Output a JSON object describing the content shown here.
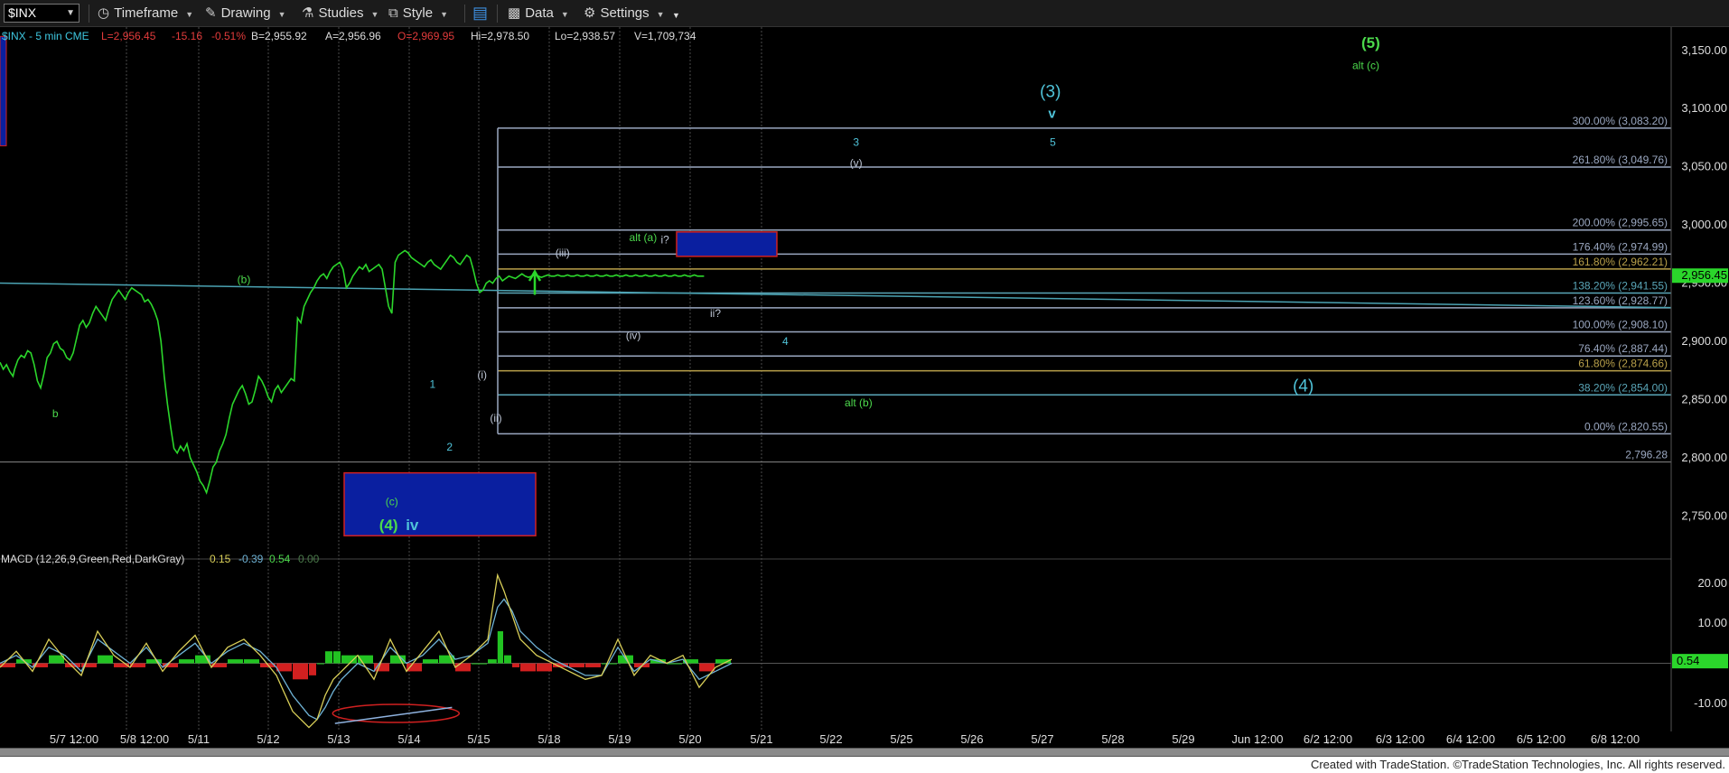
{
  "toolbar": {
    "symbol": "$INX",
    "timeframe": "Timeframe",
    "drawing": "Drawing",
    "studies": "Studies",
    "style": "Style",
    "data": "Data",
    "settings": "Settings"
  },
  "chart_data": {
    "type": "line",
    "header": {
      "symbol_line": "$INX - 5 min  CME",
      "last": "L=2,956.45",
      "change": "-15.16",
      "pct": "-0.51%",
      "bid": "B=2,955.92",
      "ask": "A=2,956.96",
      "open": "O=2,969.95",
      "high": "Hi=2,978.50",
      "low": "Lo=2,938.57",
      "volume": "V=1,709,734"
    },
    "price_axis": {
      "min": 2720,
      "max": 3170,
      "ticks": [
        "2,750.00",
        "2,800.00",
        "2,850.00",
        "2,900.00",
        "2,950.00",
        "3,000.00",
        "3,050.00",
        "3,100.00",
        "3,150.00"
      ],
      "tick_values": [
        2750,
        2800,
        2850,
        2900,
        2950,
        3000,
        3050,
        3100,
        3150
      ],
      "last_price_label": "2,956.45",
      "last_price": 2956.45
    },
    "x_axis": {
      "labels": [
        "5/7 12:00",
        "5/8 12:00",
        "5/11",
        "5/12",
        "5/13",
        "5/14",
        "5/15",
        "5/18",
        "5/19",
        "5/20",
        "5/21",
        "5/22",
        "5/25",
        "5/26",
        "5/27",
        "5/28",
        "5/29",
        "Jun 12:00",
        "6/2 12:00",
        "6/3 12:00",
        "6/4 12:00",
        "6/5 12:00",
        "6/8 12:00"
      ],
      "vertical_grid_labels": [
        "5/8 12:00",
        "5/11",
        "5/12",
        "5/13",
        "5/14",
        "5/15",
        "5/18",
        "5/19",
        "5/20",
        "5/21"
      ]
    },
    "price_series": {
      "name": "$INX",
      "bar_index": [
        0,
        4,
        8,
        12,
        16,
        18,
        22,
        26,
        30,
        34,
        38,
        42,
        46,
        50,
        54,
        58,
        62,
        66,
        70,
        74,
        78,
        82,
        86,
        90,
        94,
        98,
        102,
        106,
        110,
        114,
        118,
        122,
        126,
        130,
        134,
        138,
        142,
        146,
        150,
        154,
        158,
        162,
        166,
        170,
        174,
        178,
        182,
        186,
        190,
        194,
        198,
        202,
        206,
        210,
        214,
        218,
        222,
        226,
        230,
        234,
        238,
        242,
        246,
        250,
        254,
        258,
        262,
        266,
        270,
        274,
        278,
        282,
        286,
        290,
        294,
        298,
        302,
        306,
        310,
        314,
        318,
        322,
        326,
        330,
        334,
        338,
        342,
        346,
        350,
        354,
        358,
        362,
        366,
        370,
        374,
        378,
        382,
        386,
        390,
        394,
        398,
        402,
        406,
        410,
        414,
        418,
        422,
        426,
        430,
        434,
        438,
        442,
        446,
        450,
        454,
        458,
        462,
        466,
        470,
        474,
        478,
        482,
        486,
        490,
        494,
        498,
        502,
        506,
        510,
        514,
        518,
        522,
        526,
        530,
        534,
        538,
        542,
        546,
        550,
        554,
        558,
        562,
        566,
        570,
        574,
        578,
        582,
        586,
        590,
        594,
        598,
        602,
        606,
        610,
        614,
        618,
        622,
        626,
        630,
        634,
        638,
        642,
        646,
        650,
        654,
        658,
        662,
        666,
        670,
        674,
        678,
        682,
        686,
        690,
        694,
        698,
        702,
        706,
        710,
        714,
        718,
        722,
        726,
        730,
        734,
        738,
        742,
        746,
        750,
        754,
        758,
        762,
        766,
        770,
        774,
        778,
        782,
        786,
        790,
        794,
        798,
        802,
        806,
        810,
        814,
        818,
        822,
        826,
        830,
        834,
        838,
        842,
        846,
        850,
        854,
        858,
        862,
        866,
        870,
        874,
        878,
        882,
        886,
        890,
        894,
        898
      ],
      "close": [
        2882,
        2876,
        2880,
        2874,
        2870,
        2876,
        2884,
        2888,
        2886,
        2892,
        2890,
        2880,
        2866,
        2860,
        2872,
        2886,
        2890,
        2898,
        2900,
        2894,
        2892,
        2886,
        2884,
        2890,
        2902,
        2914,
        2918,
        2912,
        2916,
        2924,
        2930,
        2926,
        2922,
        2918,
        2928,
        2936,
        2940,
        2944,
        2940,
        2936,
        2942,
        2946,
        2944,
        2942,
        2940,
        2934,
        2936,
        2932,
        2926,
        2918,
        2900,
        2870,
        2846,
        2826,
        2808,
        2804,
        2810,
        2806,
        2812,
        2800,
        2794,
        2788,
        2780,
        2776,
        2770,
        2780,
        2792,
        2796,
        2806,
        2812,
        2820,
        2834,
        2846,
        2852,
        2858,
        2862,
        2855,
        2846,
        2848,
        2858,
        2870,
        2866,
        2860,
        2852,
        2848,
        2858,
        2862,
        2856,
        2860,
        2864,
        2868,
        2866,
        2920,
        2916,
        2930,
        2936,
        2942,
        2946,
        2952,
        2956,
        2958,
        2954,
        2960,
        2964,
        2966,
        2968,
        2962,
        2946,
        2950,
        2956,
        2960,
        2964,
        2962,
        2966,
        2960,
        2962,
        2964,
        2966,
        2962,
        2946,
        2930,
        2924,
        2968,
        2974,
        2976,
        2978,
        2976,
        2972,
        2970,
        2968,
        2966,
        2964,
        2968,
        2970,
        2966,
        2964,
        2962,
        2966,
        2970,
        2974,
        2972,
        2968,
        2966,
        2970,
        2974,
        2972,
        2962,
        2950,
        2942,
        2944,
        2950,
        2952,
        2950,
        2954,
        2956,
        2952,
        2954,
        2956,
        2955,
        2954,
        2956,
        2958,
        2956,
        2955,
        2956,
        2957,
        2956,
        2955,
        2956,
        2957,
        2956,
        2956,
        2957,
        2956,
        2956,
        2957,
        2956,
        2956,
        2957,
        2956,
        2956,
        2957,
        2956,
        2956,
        2957,
        2956,
        2956,
        2957,
        2956,
        2956,
        2957,
        2956,
        2956,
        2957,
        2956,
        2956,
        2957,
        2956,
        2956,
        2957,
        2956,
        2956,
        2957,
        2956,
        2956,
        2957,
        2956,
        2956,
        2957,
        2956,
        2956,
        2957,
        2956,
        2956,
        2957,
        2956,
        2956,
        2956
      ]
    },
    "fib_levels": [
      {
        "label": "300.00% (3,083.20)",
        "value": 3083.2,
        "color": "#9aa7c0"
      },
      {
        "label": "261.80% (3,049.76)",
        "value": 3049.76,
        "color": "#9aa7c0"
      },
      {
        "label": "200.00% (2,995.65)",
        "value": 2995.65,
        "color": "#9aa7c0"
      },
      {
        "label": "176.40% (2,974.99)",
        "value": 2974.99,
        "color": "#9aa7c0"
      },
      {
        "label": "161.80% (2,962.21)",
        "value": 2962.21,
        "color": "#b9a04a"
      },
      {
        "label": "138.20% (2,941.55)",
        "value": 2941.55,
        "color": "#5aa6b8"
      },
      {
        "label": "123.60% (2,928.77)",
        "value": 2928.77,
        "color": "#9aa7c0"
      },
      {
        "label": "100.00% (2,908.10)",
        "value": 2908.1,
        "color": "#9aa7c0"
      },
      {
        "label": "76.40% (2,887.44)",
        "value": 2887.44,
        "color": "#9aa7c0"
      },
      {
        "label": "61.80% (2,874.66)",
        "value": 2874.66,
        "color": "#b9a04a"
      },
      {
        "label": "38.20% (2,854.00)",
        "value": 2854.0,
        "color": "#5aa6b8"
      },
      {
        "label": "0.00% (2,820.55)",
        "value": 2820.55,
        "color": "#9aa7c0"
      }
    ],
    "support_level": {
      "label": "2,796.28",
      "value": 2796.28
    },
    "wave_labels": [
      {
        "text": "(5)",
        "color": "#4cd94c",
        "bar": 1686,
        "price": 3152,
        "size": 17,
        "bold": true
      },
      {
        "text": "alt (c)",
        "color": "#4cd94c",
        "bar": 1680,
        "price": 3134,
        "size": 12,
        "bold": false
      },
      {
        "text": "(3)",
        "color": "#4fc3d9",
        "bar": 1292,
        "price": 3110,
        "size": 19,
        "bold": false
      },
      {
        "text": "v",
        "color": "#4fc3d9",
        "bar": 1294,
        "price": 3092,
        "size": 15,
        "bold": true
      },
      {
        "text": "5",
        "color": "#4fc3d9",
        "bar": 1295,
        "price": 3068,
        "size": 12,
        "bold": false
      },
      {
        "text": "3",
        "color": "#4fc3d9",
        "bar": 1053,
        "price": 3068,
        "size": 12,
        "bold": false
      },
      {
        "text": "(v)",
        "color": "#bfc7d6",
        "bar": 1053,
        "price": 3050,
        "size": 12,
        "bold": false
      },
      {
        "text": "(iii)",
        "color": "#bfc7d6",
        "bar": 692,
        "price": 2973,
        "size": 12,
        "bold": false
      },
      {
        "text": "alt (a)",
        "color": "#4cd94c",
        "bar": 791,
        "price": 2986,
        "size": 12,
        "bold": false
      },
      {
        "text": "i?",
        "color": "#bfc7d6",
        "bar": 818,
        "price": 2984,
        "size": 12,
        "bold": false
      },
      {
        "text": "(iv)",
        "color": "#bfc7d6",
        "bar": 779,
        "price": 2902,
        "size": 12,
        "bold": false
      },
      {
        "text": "ii?",
        "color": "#bfc7d6",
        "bar": 880,
        "price": 2921,
        "size": 12,
        "bold": false
      },
      {
        "text": "4",
        "color": "#4fc3d9",
        "bar": 966,
        "price": 2897,
        "size": 12,
        "bold": false
      },
      {
        "text": "(b)",
        "color": "#4cd94c",
        "bar": 300,
        "price": 2950,
        "size": 12,
        "bold": false
      },
      {
        "text": "b",
        "color": "#4cd94c",
        "bar": 68,
        "price": 2835,
        "size": 12,
        "bold": false
      },
      {
        "text": "1",
        "color": "#4fc3d9",
        "bar": 532,
        "price": 2860,
        "size": 12,
        "bold": false
      },
      {
        "text": "(i)",
        "color": "#bfc7d6",
        "bar": 593,
        "price": 2868,
        "size": 12,
        "bold": false
      },
      {
        "text": "(ii)",
        "color": "#bfc7d6",
        "bar": 610,
        "price": 2831,
        "size": 12,
        "bold": false
      },
      {
        "text": "2",
        "color": "#4fc3d9",
        "bar": 553,
        "price": 2806,
        "size": 12,
        "bold": false
      },
      {
        "text": "alt (b)",
        "color": "#4cd94c",
        "bar": 1056,
        "price": 2844,
        "size": 12,
        "bold": false
      },
      {
        "text": "(4)",
        "color": "#4fc3d9",
        "bar": 1603,
        "price": 2857,
        "size": 19,
        "bold": false
      },
      {
        "text": "(c)",
        "color": "#4cd94c",
        "bar": 482,
        "price": 2759,
        "size": 12,
        "bold": false
      },
      {
        "text": "(4)",
        "color": "#4cd94c",
        "bar": 478,
        "price": 2738,
        "size": 17,
        "bold": true
      },
      {
        "text": "iv",
        "color": "#4fc3d9",
        "bar": 507,
        "price": 2738,
        "size": 17,
        "bold": true
      }
    ],
    "macd": {
      "legend": "MACD (12,26,9,Green,Red,DarkGray)",
      "macd_value": "0.15",
      "signal_value": "-0.39",
      "hist_value": "0.54",
      "zero_value": "0.00",
      "axis_min": -17,
      "axis_max": 24,
      "ticks": [
        "20.00",
        "10.00",
        "-10.00"
      ],
      "tick_values": [
        20,
        10,
        -10
      ],
      "last_label": "0.54",
      "last_value": 0.54,
      "bar_index": [
        0,
        20,
        40,
        60,
        80,
        100,
        120,
        140,
        160,
        180,
        200,
        220,
        240,
        260,
        280,
        300,
        320,
        340,
        360,
        380,
        390,
        400,
        410,
        420,
        440,
        460,
        480,
        500,
        520,
        540,
        560,
        580,
        600,
        612,
        620,
        630,
        640,
        660,
        680,
        700,
        720,
        740,
        760,
        780,
        800,
        820,
        840,
        860,
        880,
        900
      ],
      "macd_line": [
        -1,
        3,
        -2,
        6,
        1,
        -3,
        8,
        2,
        -1,
        5,
        -2,
        3,
        7,
        -1,
        4,
        6,
        2,
        -3,
        -12,
        -16,
        -14,
        -8,
        -4,
        -2,
        2,
        -4,
        6,
        -2,
        3,
        8,
        -1,
        2,
        6,
        22,
        18,
        12,
        6,
        2,
        0,
        -2,
        -4,
        -3,
        6,
        -3,
        2,
        0,
        2,
        -6,
        -1,
        1
      ],
      "signal_line": [
        0,
        2,
        -1,
        4,
        2,
        -2,
        6,
        3,
        0,
        4,
        -1,
        2,
        5,
        0,
        3,
        5,
        3,
        -1,
        -8,
        -13,
        -14,
        -11,
        -7,
        -4,
        0,
        -2,
        4,
        0,
        2,
        6,
        1,
        2,
        5,
        14,
        16,
        13,
        8,
        4,
        1,
        -1,
        -3,
        -3,
        4,
        -2,
        1,
        0,
        1,
        -4,
        -2,
        0
      ]
    }
  },
  "footer": {
    "credit": "Created with TradeStation. ©TradeStation Technologies, Inc. All rights reserved."
  },
  "colors": {
    "price_line": "#2bd62b",
    "grid": "#3a3a3a",
    "vertical_grid": "#4a4a4a",
    "trendline": "#4ba3b3",
    "box_fill": "#0a1fa0",
    "box_border": "#d02020",
    "macd_line": "#d9cf58",
    "signal_line": "#6fb3d6",
    "hist_pos": "#22c322",
    "hist_neg": "#d22020"
  }
}
